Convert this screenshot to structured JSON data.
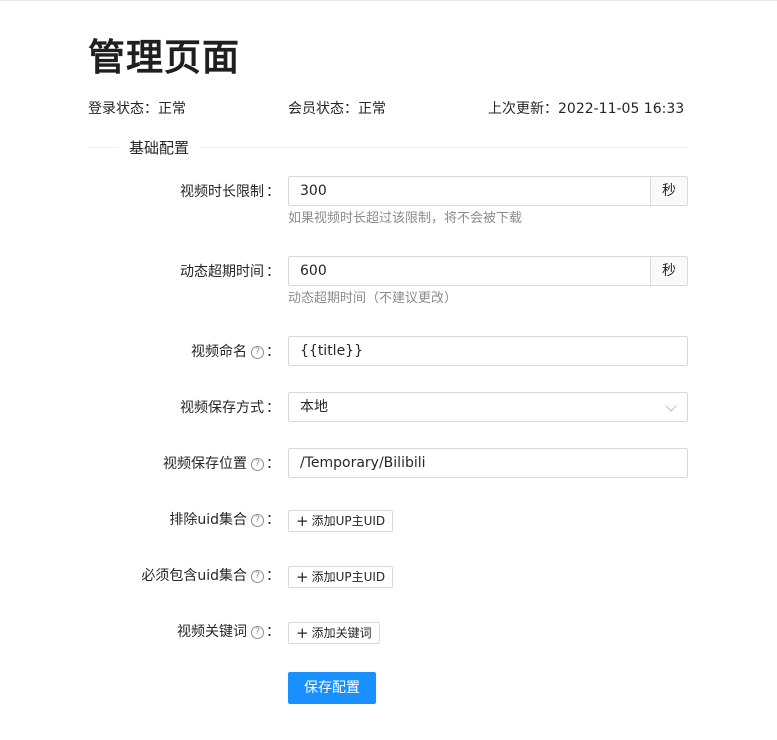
{
  "page": {
    "title": "管理页面"
  },
  "status": {
    "login": "登录状态：正常",
    "member": "会员状态：正常",
    "last_update": "上次更新：2022-11-05 16:33"
  },
  "section": {
    "title": "基础配置"
  },
  "form": {
    "duration_limit": {
      "label": "视频时长限制",
      "value": "300",
      "unit": "秒",
      "help": "如果视频时长超过该限制，将不会被下载"
    },
    "timeout": {
      "label": "动态超期时间",
      "value": "600",
      "unit": "秒",
      "help": "动态超期时间（不建议更改）"
    },
    "naming": {
      "label": "视频命名",
      "value": "{{title}}"
    },
    "save_method": {
      "label": "视频保存方式",
      "value": "本地"
    },
    "save_path": {
      "label": "视频保存位置",
      "value": "/Temporary/Bilibili"
    },
    "exclude_uid": {
      "label": "排除uid集合",
      "button": "添加UP主UID"
    },
    "include_uid": {
      "label": "必须包含uid集合",
      "button": "添加UP主UID"
    },
    "keywords": {
      "label": "视频关键词",
      "button": "添加关键词"
    },
    "colon": "：",
    "help_glyph": "?",
    "plus_glyph": "+",
    "submit": "保存配置"
  },
  "colors": {
    "primary": "#1890ff",
    "border": "#d9d9d9",
    "help_text": "#8c8c8c"
  }
}
